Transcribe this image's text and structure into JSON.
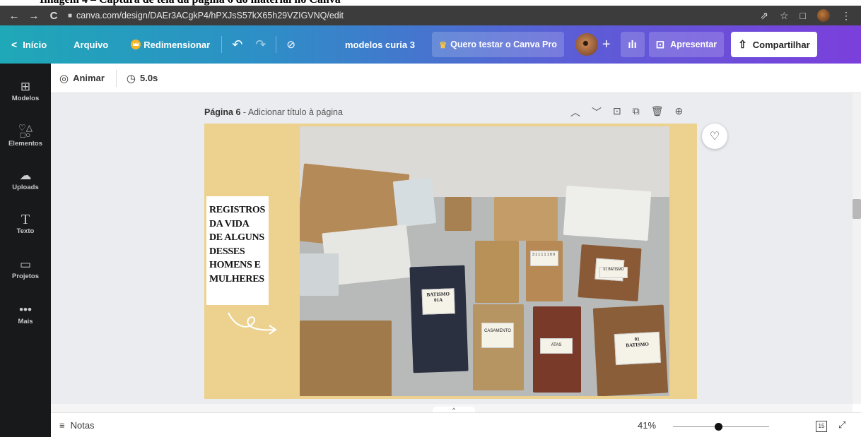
{
  "caption": "Imagem 4 – Captura de tela da página 6 do material no Canva",
  "browser": {
    "url": "canva.com/design/DAEr3ACgkP4/hPXJsS57kX65h29VZIGVNQ/edit"
  },
  "topbar": {
    "inicio": "Início",
    "arquivo": "Arquivo",
    "redimensionar": "Redimensionar",
    "design_title": "modelos curia 3",
    "pro": "Quero testar o Canva Pro",
    "apresentar": "Apresentar",
    "compartilhar": "Compartilhar"
  },
  "sidebar": {
    "items": [
      {
        "label": "Modelos",
        "icon": "layout-icon"
      },
      {
        "label": "Elementos",
        "icon": "shapes-icon"
      },
      {
        "label": "Uploads",
        "icon": "cloud-upload-icon"
      },
      {
        "label": "Texto",
        "icon": "text-icon"
      },
      {
        "label": "Projetos",
        "icon": "folder-icon"
      },
      {
        "label": "Mais",
        "icon": "more-icon"
      }
    ]
  },
  "toolbar": {
    "animar": "Animar",
    "duration": "5.0s"
  },
  "page": {
    "label": "Página 6",
    "title_placeholder": "Adicionar título à página",
    "text_lines": [
      "REGISTROS",
      "DA VIDA",
      "DE ALGUNS",
      "DESSES",
      "HOMENS E",
      "MULHERES"
    ]
  },
  "photo_labels": {
    "batismo1": "BATISMO",
    "batismo1_num": "01A",
    "casamento": "CASAMENTO",
    "atas": "ATAS",
    "batismo2": "BATISMO",
    "batismo2_num": "01",
    "batismo3": "BATISMO",
    "batismo3_num": "01",
    "ledger": "3 1 1 1 1 1 0 0"
  },
  "bottom": {
    "notas": "Notas",
    "zoom": "41%",
    "page_count": "15"
  },
  "colors": {
    "page_bg": "#ecd28e",
    "sidebar": "#18191b",
    "canvas_bg": "#ebecf0"
  }
}
